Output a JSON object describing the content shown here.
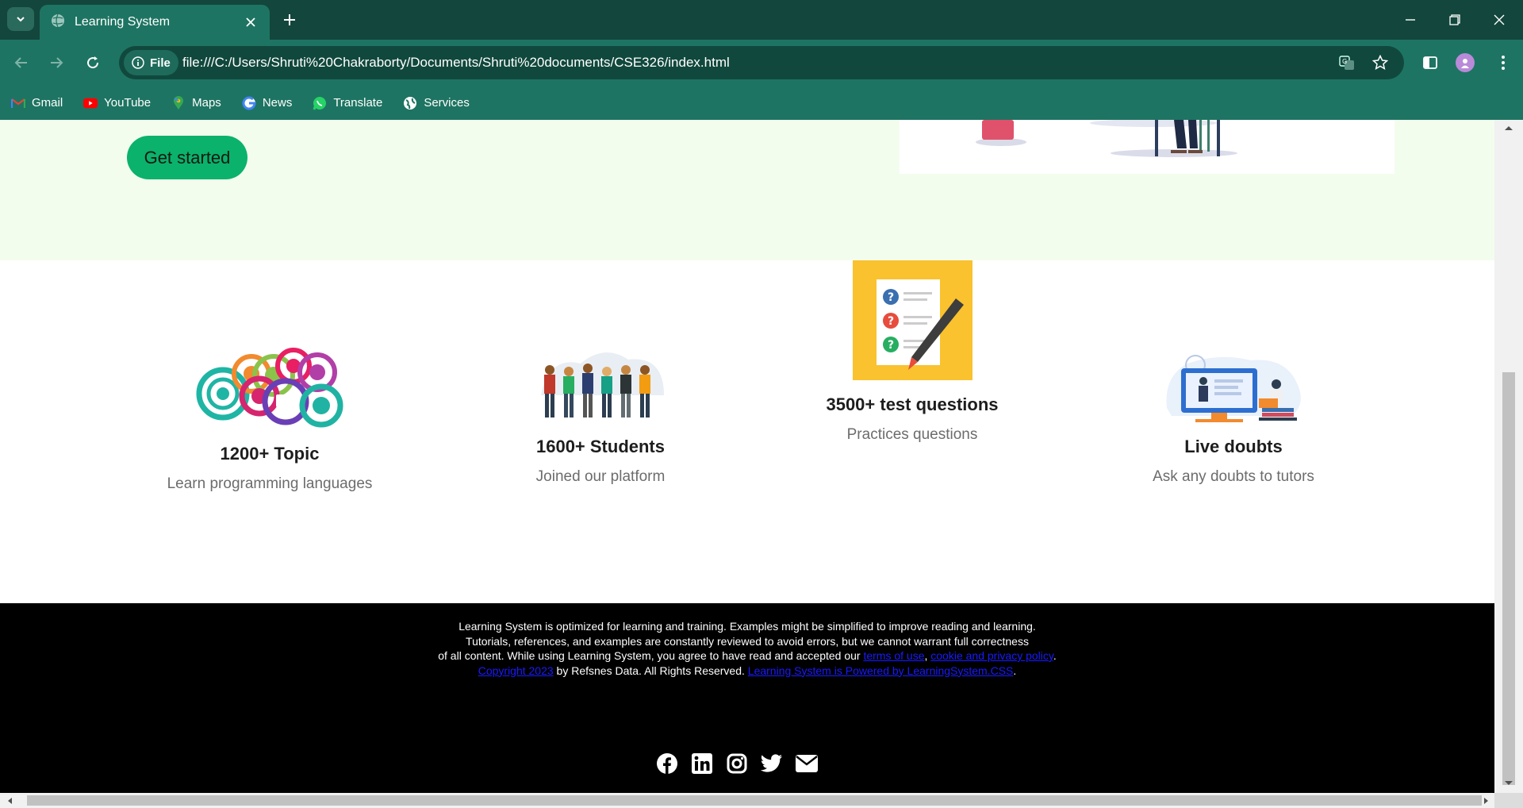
{
  "browser": {
    "tab_title": "Learning System",
    "url_chip": "File",
    "url": "file:///C:/Users/Shruti%20Chakraborty/Documents/Shruti%20documents/CSE326/index.html",
    "bookmarks": [
      {
        "label": "Gmail",
        "icon": "gmail-icon"
      },
      {
        "label": "YouTube",
        "icon": "youtube-icon"
      },
      {
        "label": "Maps",
        "icon": "maps-icon"
      },
      {
        "label": "News",
        "icon": "google-news-icon"
      },
      {
        "label": "Translate",
        "icon": "whatsapp-icon"
      },
      {
        "label": "Services",
        "icon": "globe-icon"
      }
    ]
  },
  "hero": {
    "cta_label": "Get started"
  },
  "features": [
    {
      "heading": "1200+ Topic",
      "sub": "Learn programming languages",
      "icon": "topics-circles-illustration"
    },
    {
      "heading": "1600+ Students",
      "sub": "Joined our platform",
      "icon": "students-group-illustration"
    },
    {
      "heading": "3500+ test questions",
      "sub": "Practices questions",
      "icon": "quiz-questions-illustration"
    },
    {
      "heading": "Live doubts",
      "sub": "Ask any doubts to tutors",
      "icon": "online-tutor-illustration"
    }
  ],
  "footer": {
    "line1": "Learning System is optimized for learning and training. Examples might be simplified to improve reading and learning.",
    "line2": "Tutorials, references, and examples are constantly reviewed to avoid errors, but we cannot warrant full correctness",
    "line3_pre": "of all content. While using Learning System, you agree to have read and accepted our ",
    "terms_link": "terms of use",
    "line3_sep": ", ",
    "cookie_link": "cookie and privacy policy",
    "line3_end": ".",
    "copyright_link": "Copyright 2023",
    "line4_mid": " by Refsnes Data. All Rights Reserved. ",
    "powered_link": "Learning System is Powered by LearningSystem.CSS",
    "line4_end": ".",
    "social": [
      "facebook-icon",
      "linkedin-icon",
      "instagram-icon",
      "twitter-icon",
      "email-icon"
    ]
  },
  "colors": {
    "tabbar": "#13463c",
    "toolbar": "#1e7462",
    "hero_bg": "#f3fdee",
    "cta": "#0bb26b",
    "footer_bg": "#000000"
  }
}
